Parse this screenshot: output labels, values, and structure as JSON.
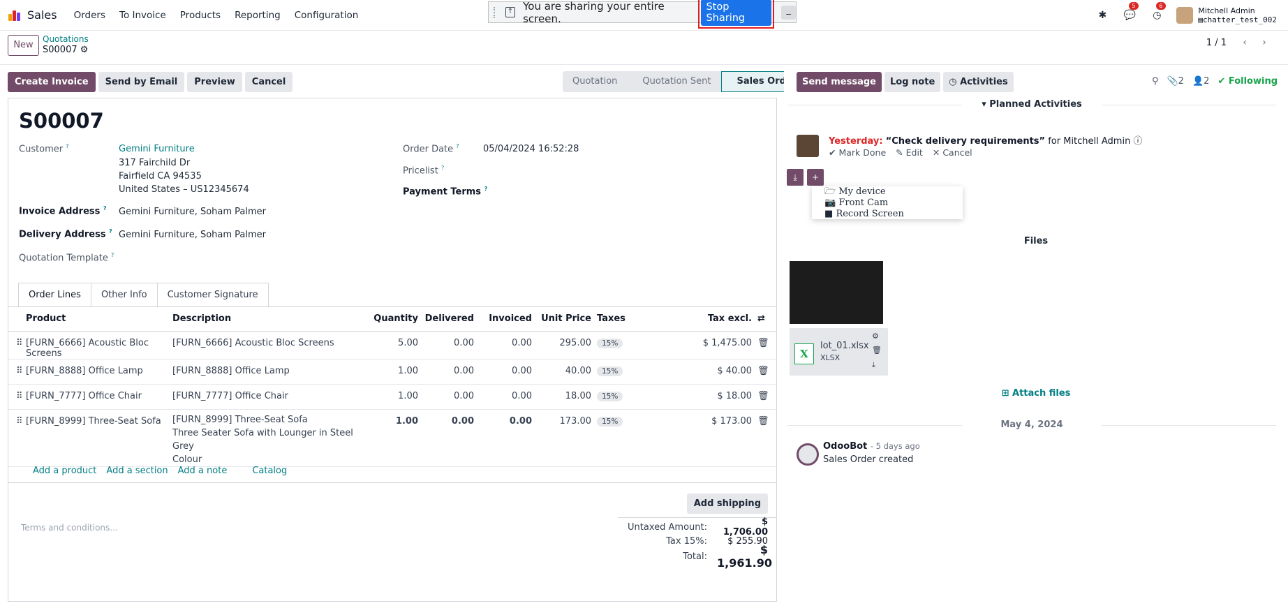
{
  "topbar": {
    "app_name": "Sales",
    "menu": [
      "Orders",
      "To Invoice",
      "Products",
      "Reporting",
      "Configuration"
    ],
    "messages_badge": "5",
    "activities_badge": "6",
    "user_name": "Mitchell Admin",
    "db_name": "chatter_test_002"
  },
  "share_bar": {
    "message": "You are sharing your entire screen.",
    "stop_label": "Stop Sharing",
    "hide_label": "_"
  },
  "control": {
    "new_label": "New",
    "breadcrumb_parent": "Quotations",
    "breadcrumb_current": "S00007",
    "pager": "1 / 1"
  },
  "actions": {
    "create_invoice": "Create Invoice",
    "send_email": "Send by Email",
    "preview": "Preview",
    "cancel": "Cancel"
  },
  "stages": [
    "Quotation",
    "Quotation Sent",
    "Sales Order"
  ],
  "order": {
    "name": "S00007",
    "customer_label": "Customer",
    "customer_name": "Gemini Furniture",
    "addr1": "317 Fairchild Dr",
    "addr2": "Fairfield CA 94535",
    "addr3": "United States – US12345674",
    "invoice_addr_label": "Invoice Address",
    "invoice_addr": "Gemini Furniture, Soham Palmer",
    "delivery_addr_label": "Delivery Address",
    "delivery_addr": "Gemini Furniture, Soham Palmer",
    "template_label": "Quotation Template",
    "order_date_label": "Order Date",
    "order_date": "05/04/2024 16:52:28",
    "pricelist_label": "Pricelist",
    "payment_terms_label": "Payment Terms"
  },
  "tabs": [
    "Order Lines",
    "Other Info",
    "Customer Signature"
  ],
  "lines_header": {
    "product": "Product",
    "description": "Description",
    "quantity": "Quantity",
    "delivered": "Delivered",
    "invoiced": "Invoiced",
    "unit_price": "Unit Price",
    "taxes": "Taxes",
    "tax_excl": "Tax excl."
  },
  "lines": [
    {
      "product": "[FURN_6666] Acoustic Bloc Screens",
      "description": "[FURN_6666] Acoustic Bloc Screens",
      "desc2": "",
      "desc3": "",
      "qty": "5.00",
      "delivered": "0.00",
      "invoiced": "0.00",
      "price": "295.00",
      "tax": "15%",
      "subtotal": "$ 1,475.00"
    },
    {
      "product": "[FURN_8888] Office Lamp",
      "description": "[FURN_8888] Office Lamp",
      "desc2": "",
      "desc3": "",
      "qty": "1.00",
      "delivered": "0.00",
      "invoiced": "0.00",
      "price": "40.00",
      "tax": "15%",
      "subtotal": "$ 40.00"
    },
    {
      "product": "[FURN_7777] Office Chair",
      "description": "[FURN_7777] Office Chair",
      "desc2": "",
      "desc3": "",
      "qty": "1.00",
      "delivered": "0.00",
      "invoiced": "0.00",
      "price": "18.00",
      "tax": "15%",
      "subtotal": "$ 18.00"
    },
    {
      "product": "[FURN_8999] Three-Seat Sofa",
      "description": "[FURN_8999] Three-Seat Sofa",
      "desc2": "Three Seater Sofa with Lounger in Steel Grey",
      "desc3": "Colour",
      "qty": "1.00",
      "delivered": "0.00",
      "invoiced": "0.00",
      "price": "173.00",
      "tax": "15%",
      "subtotal": "$ 173.00"
    }
  ],
  "add_links": {
    "product": "Add a product",
    "section": "Add a section",
    "note": "Add a note",
    "catalog": "Catalog"
  },
  "add_shipping": "Add shipping",
  "terms_placeholder": "Terms and conditions...",
  "totals": {
    "untaxed_label": "Untaxed Amount:",
    "untaxed": "$ 1,706.00",
    "tax_label": "Tax 15%:",
    "tax": "$ 255.90",
    "total_label": "Total:",
    "total": "$ 1,961.90"
  },
  "chatter": {
    "send_message": "Send message",
    "log_note": "Log note",
    "activities": "Activities",
    "attachments_count": "2",
    "followers_count": "2",
    "following": "Following",
    "planned_title": "Planned Activities",
    "activity_when": "Yesterday:",
    "activity_summary": "“Check delivery requirements”",
    "activity_for": "for Mitchell Admin",
    "mark_done": "Mark Done",
    "edit": "Edit",
    "cancel": "Cancel",
    "upload_menu": [
      "My device",
      "Front Cam",
      "Record Screen"
    ],
    "files_title": "Files",
    "file_name": "lot_01.xlsx",
    "file_type": "XLSX",
    "attach_files": "Attach files",
    "date_divider": "May 4, 2024",
    "author": "OdooBot",
    "author_time": "- 5 days ago",
    "message": "Sales Order created"
  },
  "colors": {
    "brand": "#714b67",
    "link": "#017e84",
    "stop": "#1a73e8",
    "highlight": "#e11d1d"
  }
}
